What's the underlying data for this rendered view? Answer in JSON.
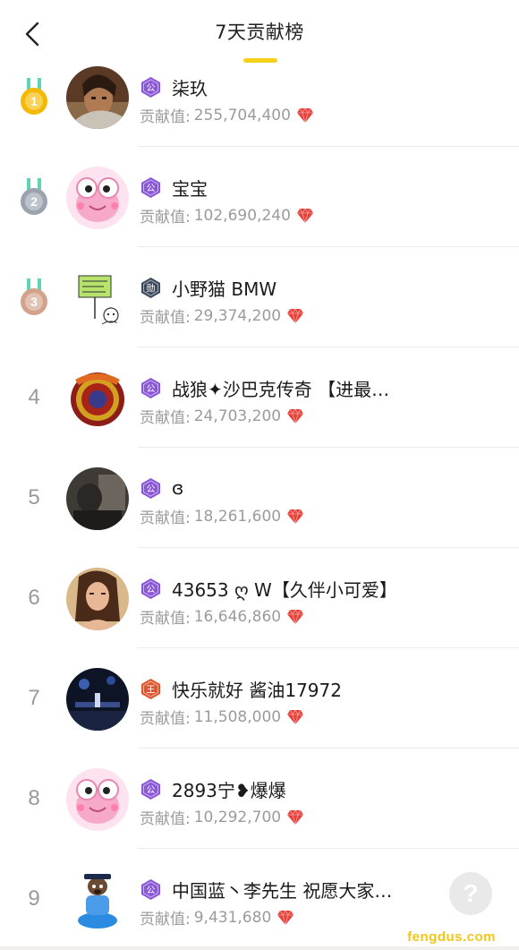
{
  "header": {
    "title": "7天贡献榜",
    "back_icon": "chevron-left-icon",
    "underline_color": "#F8D21A"
  },
  "score_label": "贡献值:",
  "gem_icon": "red-diamond-icon",
  "gem_color": "#E8413A",
  "medal_colors": {
    "gold": "#F5B800",
    "silver": "#9AA3AE",
    "bronze": "#D2A28B",
    "ribbon": "#5ED6B5"
  },
  "badge_colors": {
    "公": "#8B56D8",
    "勋": "#3C4A5E",
    "王": "#E0542E"
  },
  "rows": [
    {
      "rank": "1",
      "medal": "gold",
      "badge": "公",
      "name": "柒玖",
      "score": "255,704,400"
    },
    {
      "rank": "2",
      "medal": "silver",
      "badge": "公",
      "name": "宝宝",
      "score": "102,690,240"
    },
    {
      "rank": "3",
      "medal": "bronze",
      "badge": "勋",
      "name": "小野猫 BMW",
      "score": "29,374,200"
    },
    {
      "rank": "4",
      "medal": "",
      "badge": "公",
      "name": "战狼✦沙巴克传奇 【进最…",
      "score": "24,703,200"
    },
    {
      "rank": "5",
      "medal": "",
      "badge": "公",
      "name": "ɞ",
      "score": "18,261,600"
    },
    {
      "rank": "6",
      "medal": "",
      "badge": "公",
      "name": "43653 ღ W【久伴小可爱】",
      "score": "16,646,860"
    },
    {
      "rank": "7",
      "medal": "",
      "badge": "王",
      "name": "快乐就好 酱油17972",
      "score": "11,508,000"
    },
    {
      "rank": "8",
      "medal": "",
      "badge": "公",
      "name": "2893宁❥爆爆",
      "score": "10,292,700"
    },
    {
      "rank": "9",
      "medal": "",
      "badge": "公",
      "name": "中国蓝丶李先生 祝愿大家…",
      "score": "9,431,680"
    }
  ],
  "help_button": {
    "label": "?",
    "icon": "help-icon"
  },
  "watermark": "fengdus.com"
}
